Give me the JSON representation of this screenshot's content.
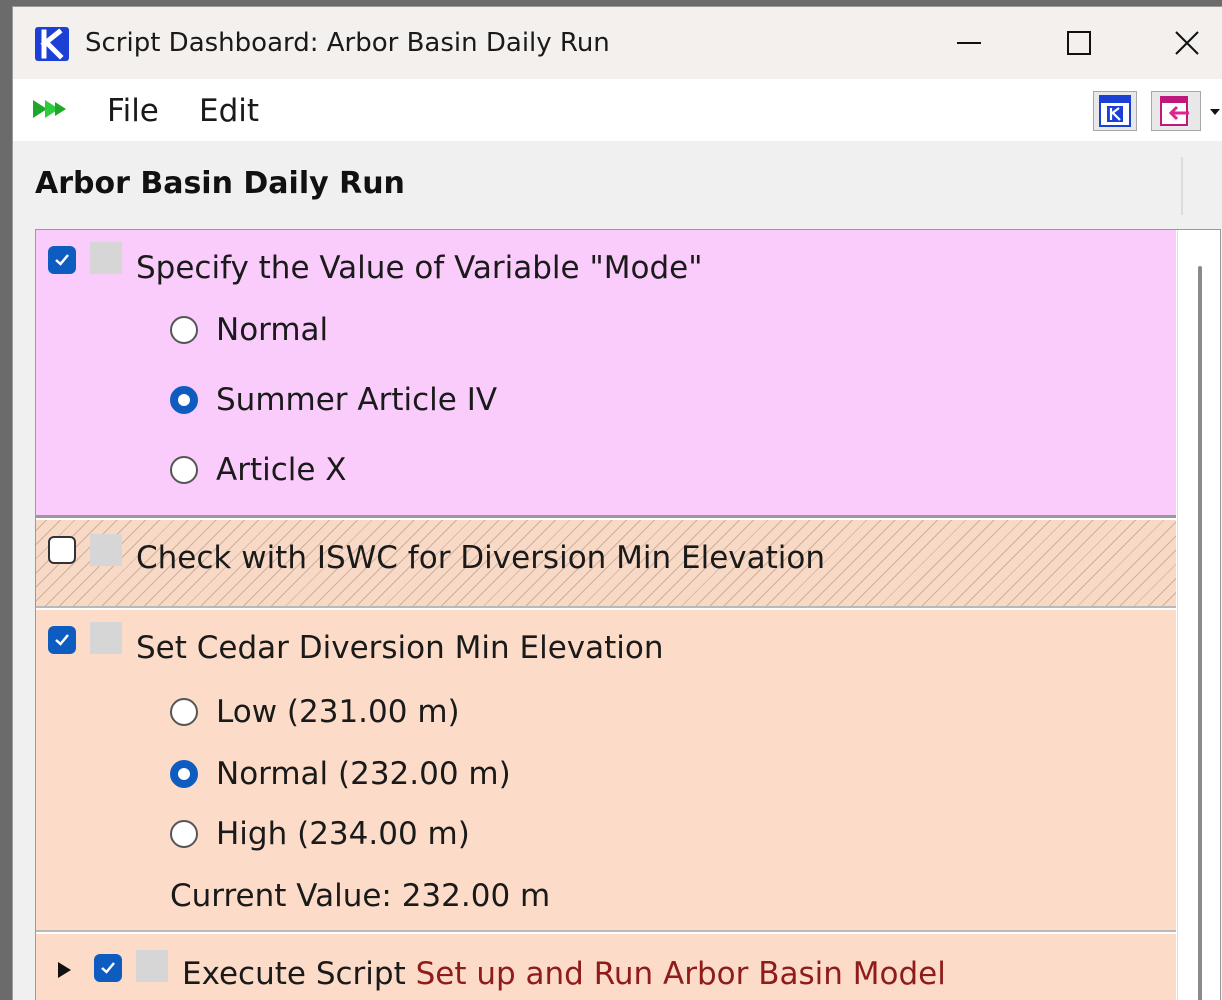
{
  "window": {
    "title": "Script Dashboard: Arbor Basin Daily Run",
    "controls": {
      "minimize_icon": "minimize-icon",
      "maximize_icon": "maximize-icon",
      "close_icon": "close-icon"
    }
  },
  "menu": {
    "items": [
      "File",
      "Edit"
    ],
    "run_icon": "run-script-icon",
    "toolbar_icons": [
      "rw-workspace-icon",
      "import-arrow-icon"
    ]
  },
  "dashboard": {
    "title": "Arbor Basin Daily Run",
    "actions": [
      {
        "label": "Specify the Value of Variable \"Mode\"",
        "enabled": true,
        "background": "#f9ccfc",
        "options": [
          {
            "label": "Normal",
            "selected": false
          },
          {
            "label": "Summer Article IV",
            "selected": true
          },
          {
            "label": "Article X",
            "selected": false
          }
        ]
      },
      {
        "label": "Check with ISWC for Diversion Min Elevation",
        "enabled": false,
        "background": "#f7d9c6"
      },
      {
        "label": "Set Cedar Diversion Min Elevation",
        "enabled": true,
        "background": "#fcdcc9",
        "options": [
          {
            "label": "Low (231.00 m)",
            "selected": false
          },
          {
            "label": "Normal (232.00 m)",
            "selected": true
          },
          {
            "label": "High (234.00 m)",
            "selected": false
          }
        ],
        "current_value": "Current Value: 232.00 m"
      },
      {
        "prefix": "Execute Script ",
        "script_name": "Set up and Run Arbor Basin Model",
        "enabled": true,
        "background": "#fcdcc9"
      }
    ]
  },
  "colors": {
    "accent": "#0f5cc0",
    "script_link": "#8f1b1b"
  }
}
